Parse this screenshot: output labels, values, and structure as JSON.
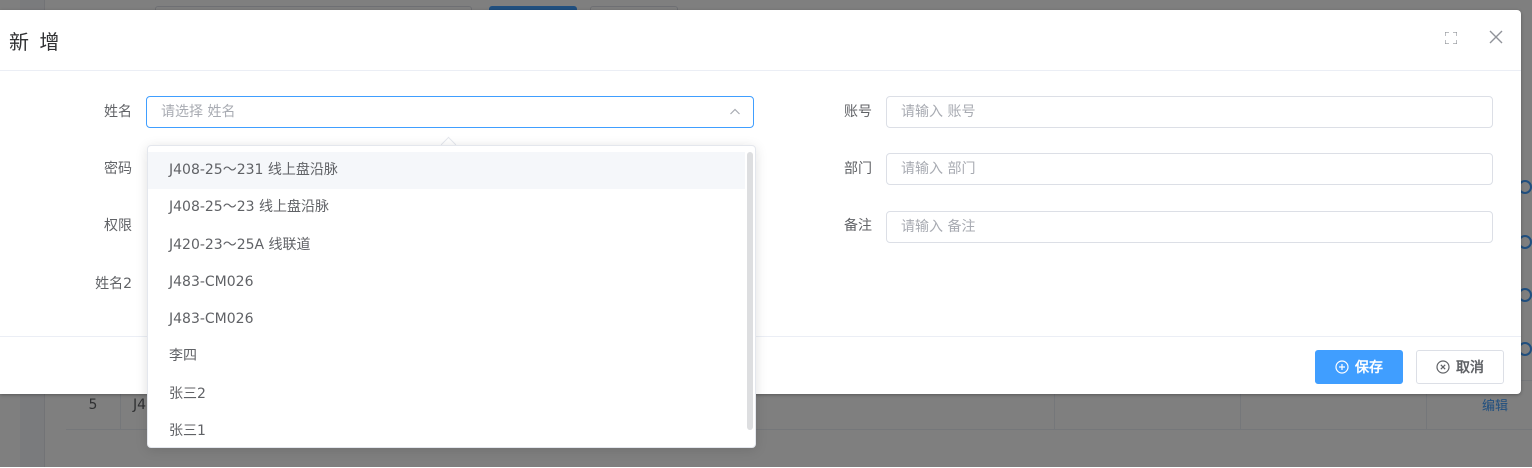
{
  "background": {
    "row_index": "5",
    "row_code": "J4",
    "edit_link": "编辑"
  },
  "dialog": {
    "title": "新 增"
  },
  "form": {
    "name": {
      "label": "姓名",
      "placeholder": "请选择 姓名"
    },
    "account": {
      "label": "账号",
      "placeholder": "请输入 账号"
    },
    "password": {
      "label": "密码"
    },
    "department": {
      "label": "部门",
      "placeholder": "请输入 部门"
    },
    "permission": {
      "label": "权限"
    },
    "remark": {
      "label": "备注",
      "placeholder": "请输入 备注"
    },
    "name2": {
      "label": "姓名2"
    }
  },
  "dropdown": {
    "options": [
      "J408-25～231 线上盘沿脉",
      "J408-25～23 线上盘沿脉",
      "J420-23～25A 线联道",
      "J483-CM026",
      "J483-CM026",
      "李四",
      "张三2",
      "张三1"
    ]
  },
  "footer": {
    "save_label": "保存",
    "cancel_label": "取消"
  },
  "colors": {
    "primary": "#409eff",
    "overlay": "rgba(0,0,0,0.5)"
  }
}
